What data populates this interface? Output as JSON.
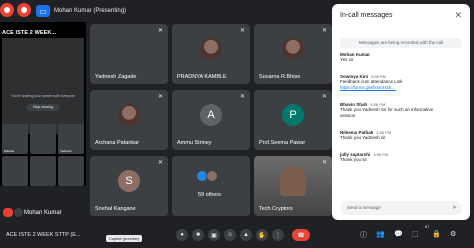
{
  "topbar": {
    "present_label": "Mohan Kumar (Presenting)"
  },
  "left_panel": {
    "meeting_title": "ACE ISTE 2 WEEK...",
    "sharing_msg": "You’re sharing your screen with everyone",
    "stop_label": "Stop sharing",
    "presenter_name": "Mohan Kumar",
    "thumb_labels": [
      "Nilesha",
      "",
      "Yadnesh",
      "",
      "",
      ""
    ]
  },
  "participants": [
    {
      "name": "Yadnesh Zagade",
      "initial": "",
      "color": "#3c4043"
    },
    {
      "name": "PRADNYA KAMBLE",
      "initial": "",
      "color": "#3c4043"
    },
    {
      "name": "Suvarna R.Bhise",
      "initial": "",
      "color": "#3c4043"
    },
    {
      "name": "Archana Patankar",
      "initial": "",
      "color": "#3c4043"
    },
    {
      "name": "Ammu Striney",
      "initial": "A",
      "color": "#5f6368"
    },
    {
      "name": "Prof.Seema Pawar",
      "initial": "P",
      "color": "#00796b"
    },
    {
      "name": "Snehal Kangane",
      "initial": "S",
      "color": "#8d6e63"
    },
    {
      "name": "59 others",
      "initial": "",
      "color": "#3c4043"
    },
    {
      "name": "Tech Cryptors",
      "initial": "",
      "color": "#3c4043"
    }
  ],
  "chat": {
    "title": "In-call messages",
    "close_icon": "close-icon",
    "recording_banner": "Messages are being recorded with the call",
    "messages": [
      {
        "author": "Mohan Kumar",
        "time": "",
        "lines": [
          "Yes sir"
        ]
      },
      {
        "author": "Sowmya Kini",
        "time": "3:56 PM",
        "lines": [
          "Feedback cum attendance Link"
        ],
        "link": "https://forms.gle/fxxmH1E…"
      },
      {
        "author": "Bhavin Shah",
        "time": "3:56 PM",
        "lines": [
          "Thank you Yadnesh Sir for such an informative",
          "session"
        ]
      },
      {
        "author": "Nileema Pathak",
        "time": "3:56 PM",
        "lines": [
          "Thank you Yadnesh sir"
        ]
      },
      {
        "author": "jully saptarshi",
        "time": "3:56 PM",
        "lines": [
          "Thank you sir"
        ]
      }
    ],
    "input_placeholder": "Send a message",
    "send_icon": "send-icon"
  },
  "bottombar": {
    "meeting_name": "ACE ISTE 2 WEEK STTP (E...",
    "tooltip": "Copilot (preview)",
    "badge": "67",
    "colors": {
      "hangup": "#ea4335",
      "button": "#3c4043"
    }
  }
}
